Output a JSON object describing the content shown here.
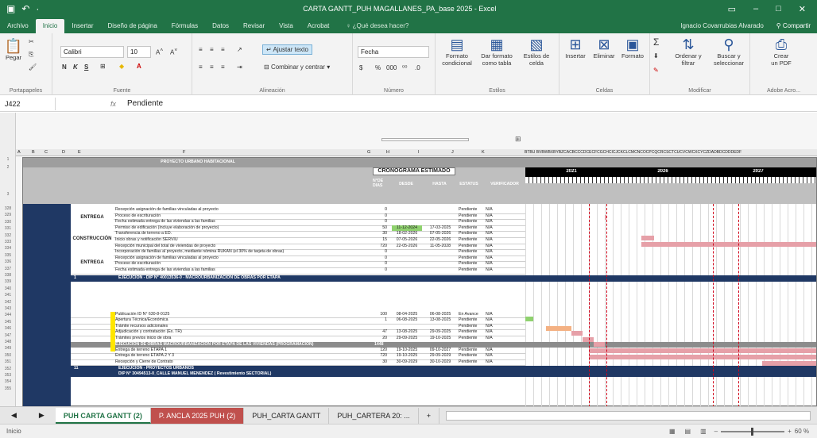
{
  "window": {
    "title": "CARTA GANTT_PUH MAGALLANES_PA_base 2025 - Excel"
  },
  "tabs": [
    "Archivo",
    "Inicio",
    "Insertar",
    "Diseño de página",
    "Fórmulas",
    "Datos",
    "Revisar",
    "Vista",
    "Acrobat"
  ],
  "tell_me": "¿Qué desea hacer?",
  "user": "Ignacio Covarrubias Alvarado",
  "share": "Compartir",
  "ribbon": {
    "paste": "Pegar",
    "clipboard": "Portapapeles",
    "font_name": "Calibri",
    "font_size": "10",
    "bold": "N",
    "italic": "K",
    "underline": "S",
    "font_group": "Fuente",
    "wrap": "Ajustar texto",
    "merge": "Combinar y centrar",
    "alignment_group": "Alineación",
    "number_format": "Fecha",
    "currency": "$",
    "percent": "%",
    "thousands": "000",
    "number_group": "Número",
    "cond_format_1": "Formato",
    "cond_format_2": "condicional",
    "table_format_1": "Dar formato",
    "table_format_2": "como tabla",
    "cell_styles_1": "Estilos de",
    "cell_styles_2": "celda",
    "styles_group": "Estilos",
    "insert": "Insertar",
    "delete": "Eliminar",
    "format": "Formato",
    "cells_group": "Celdas",
    "sort_1": "Ordenar y",
    "sort_2": "filtrar",
    "find_1": "Buscar y",
    "find_2": "seleccionar",
    "modify_group": "Modificar",
    "pdf_1": "Crear",
    "pdf_2": "un PDF",
    "acrobat_group": "Adobe Acro..."
  },
  "formula_bar": {
    "cell": "J422",
    "fx": "fx",
    "value": "Pendiente"
  },
  "sheet": {
    "project_title": "PROYECTO URBANO HABITACIONAL",
    "cronograma": "CRONOGRAMA ESTIMADO",
    "dias": "N°DE DIAS",
    "desde": "DESDE",
    "hasta": "HASTA",
    "estatus": "ESTATUS",
    "verificador": "VERIFICADOR",
    "years": [
      "2021",
      "2026",
      "2027"
    ],
    "col_letters": [
      "A",
      "B",
      "C",
      "D",
      "E",
      "F",
      "G",
      "H",
      "I",
      "J",
      "K"
    ],
    "extra_cols": "BTBU BVBWBXBYBZCACBCCCDCECFCGCHCICJCKCLCMCNCOCPCQCRCSCTCUCVCWCXCYCZDADBDCDDDEDF",
    "row_numbers": [
      "1",
      "2",
      "3",
      "328",
      "329",
      "330",
      "331",
      "332",
      "333",
      "334",
      "335",
      "336",
      "337",
      "338",
      "339",
      "340",
      "341",
      "342",
      "343",
      "344",
      "345",
      "346",
      "347",
      "348",
      "349",
      "350",
      "351",
      "352",
      "353",
      "354",
      "355"
    ],
    "sections": [
      "ENTREGA",
      "CONSTRUCCIÓN",
      "ENTREGA"
    ],
    "rows": [
      {
        "desc": "Recepción asignación de familias vinculadas al proyecto",
        "dias": "0",
        "desde": "",
        "hasta": "",
        "estatus": "Pendiente",
        "verif": "N/A"
      },
      {
        "desc": "Proceso de escrituración",
        "dias": "0",
        "desde": "",
        "hasta": "",
        "estatus": "Pendiente",
        "verif": "N/A"
      },
      {
        "desc": "Fecha estimada entrega de las viviendas a las familias",
        "dias": "0",
        "desde": "",
        "hasta": "",
        "estatus": "Pendiente",
        "verif": "N/A"
      },
      {
        "desc": "Permiso de edificación (Incluye elaboración de proyecto)",
        "dias": "50",
        "desde": "11-12-2024",
        "hasta": "17-03-2025",
        "estatus": "Pendiente",
        "verif": "N/A"
      },
      {
        "desc": "Transferencia de terreno a ED.",
        "dias": "30",
        "desde": "18-02-2026",
        "hasta": "07-05-2026",
        "estatus": "Pendiente",
        "verif": "N/A"
      },
      {
        "desc": "Inicio obras y notificación SERVIU",
        "dias": "15",
        "desde": "07-05-2026",
        "hasta": "22-05-2026",
        "estatus": "Pendiente",
        "verif": "N/A"
      },
      {
        "desc": "Recepción municipal del total de viviendas de proyecto",
        "dias": "720",
        "desde": "22-05-2026",
        "hasta": "11-05-2028",
        "estatus": "Pendiente",
        "verif": "N/A"
      },
      {
        "desc": "Incorporación de familias al proyecto, mediante nómina RUKAN (el 30% de tarjeta de obras)",
        "dias": "0",
        "desde": "",
        "hasta": "",
        "estatus": "Pendiente",
        "verif": "N/A"
      },
      {
        "desc": "Recepción asignación de familias vinculadas al proyecto",
        "dias": "0",
        "desde": "",
        "hasta": "",
        "estatus": "Pendiente",
        "verif": "N/A"
      },
      {
        "desc": "Proceso de escrituración",
        "dias": "0",
        "desde": "",
        "hasta": "",
        "estatus": "Pendiente",
        "verif": "N/A"
      },
      {
        "desc": "Fecha estimada entrega de las viviendas a las familias",
        "dias": "0",
        "desde": "",
        "hasta": "",
        "estatus": "Pendiente",
        "verif": "N/A"
      }
    ],
    "exec1": "EJECUCIÓN - DIP N° 40013536-0 - MACROURBANIZACIÓN DE OBRAS POR ETAPA",
    "exec1_num": "1",
    "rows2": [
      {
        "desc": "Publicación ID N° 630-8-0125",
        "dias": "100",
        "desde": "08-04-2025",
        "hasta": "06-08-2025",
        "estatus": "En Avance",
        "verif": "N/A"
      },
      {
        "desc": "Apertura Técnica/Económica",
        "dias": "1",
        "desde": "06-08-2025",
        "hasta": "13-08-2025",
        "estatus": "Pendiente",
        "verif": "N/A"
      },
      {
        "desc": "Trámite recursos adicionales",
        "dias": "",
        "desde": "",
        "hasta": "",
        "estatus": "Pendiente",
        "verif": "N/A"
      },
      {
        "desc": "Adjudicación y contratación (Ex. TR)",
        "dias": "47",
        "desde": "13-08-2025",
        "hasta": "29-09-2025",
        "estatus": "Pendiente",
        "verif": "N/A"
      },
      {
        "desc": "Trámites previos inicio de obra",
        "dias": "20",
        "desde": "29-09-2025",
        "hasta": "19-10-2025",
        "estatus": "Pendiente",
        "verif": "N/A"
      },
      {
        "desc": "Entrega de terreno ETAPA 1",
        "dias": "120",
        "desde": "19-10-2025",
        "hasta": "09-10-2027",
        "estatus": "Pendiente",
        "verif": "N/A"
      },
      {
        "desc": "Entrega de terreno ETAPA 2 Y 3",
        "dias": "720",
        "desde": "19-10-2025",
        "hasta": "29-09-2029",
        "estatus": "Pendiente",
        "verif": "N/A"
      },
      {
        "desc": "Recepción y Cierre de Contrato",
        "dias": "30",
        "desde": "30-09-2029",
        "hasta": "30-10-2029",
        "estatus": "Pendiente",
        "verif": "N/A"
      }
    ],
    "exec_summary": "EJECUCIÓN DE OBRAS MACROURBANIZACIÓN POR ETAPA DE LAS VIVIENDAS (PROGRAMACIÓN)",
    "exec_summary_dias": "1448",
    "exec2": "EJECUCIÓN - PROYECTOS URBANOS",
    "exec2_num": "11",
    "exec3": "DIP N° 30494513-0_CALLE MANUEL MENÉNDEZ ( Revestimiento SECTORIAL)"
  },
  "sheet_tabs": [
    "PUH CARTA GANTT (2)",
    "P. ANCLA 2025 PUH (2)",
    "PUH_CARTA GANTT",
    "PUH_CARTERA 20: ..."
  ],
  "add_sheet": "+",
  "status": {
    "mode": "Inicio",
    "zoom": "60 %"
  },
  "colors": {
    "excel_green": "#217346",
    "navy": "#1f3864",
    "gantt_pink": "#e6a0a8",
    "green_cell": "#8fd16e",
    "orange_bar": "#f4b183",
    "deadline_red": "#d0021b"
  }
}
